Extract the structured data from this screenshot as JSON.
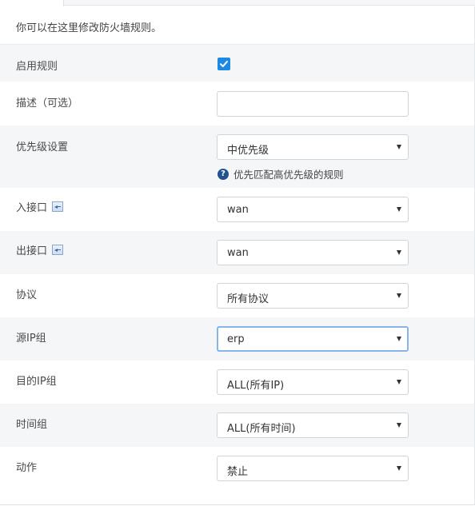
{
  "intro_text": "你可以在这里修改防火墙规则。",
  "fields": {
    "enable_rule": {
      "label": "启用规则",
      "checked": true
    },
    "description": {
      "label": "描述（可选）",
      "value": "",
      "placeholder": ""
    },
    "priority": {
      "label": "优先级设置",
      "value": "中优先级",
      "hint": "优先匹配高优先级的规则"
    },
    "in_interface": {
      "label": "入接口",
      "value": "wan",
      "icon": "interface-icon"
    },
    "out_interface": {
      "label": "出接口",
      "value": "wan",
      "icon": "interface-icon"
    },
    "protocol": {
      "label": "协议",
      "value": "所有协议"
    },
    "source_ip_group": {
      "label": "源IP组",
      "value": "erp"
    },
    "dest_ip_group": {
      "label": "目的IP组",
      "value": "ALL(所有IP)"
    },
    "time_group": {
      "label": "时间组",
      "value": "ALL(所有时间)"
    },
    "action": {
      "label": "动作",
      "value": "禁止"
    }
  },
  "colors": {
    "accent": "#1e88e5",
    "help": "#23528f",
    "row_shade": "#f5f6f8",
    "focus_border": "#8ab4e8"
  }
}
